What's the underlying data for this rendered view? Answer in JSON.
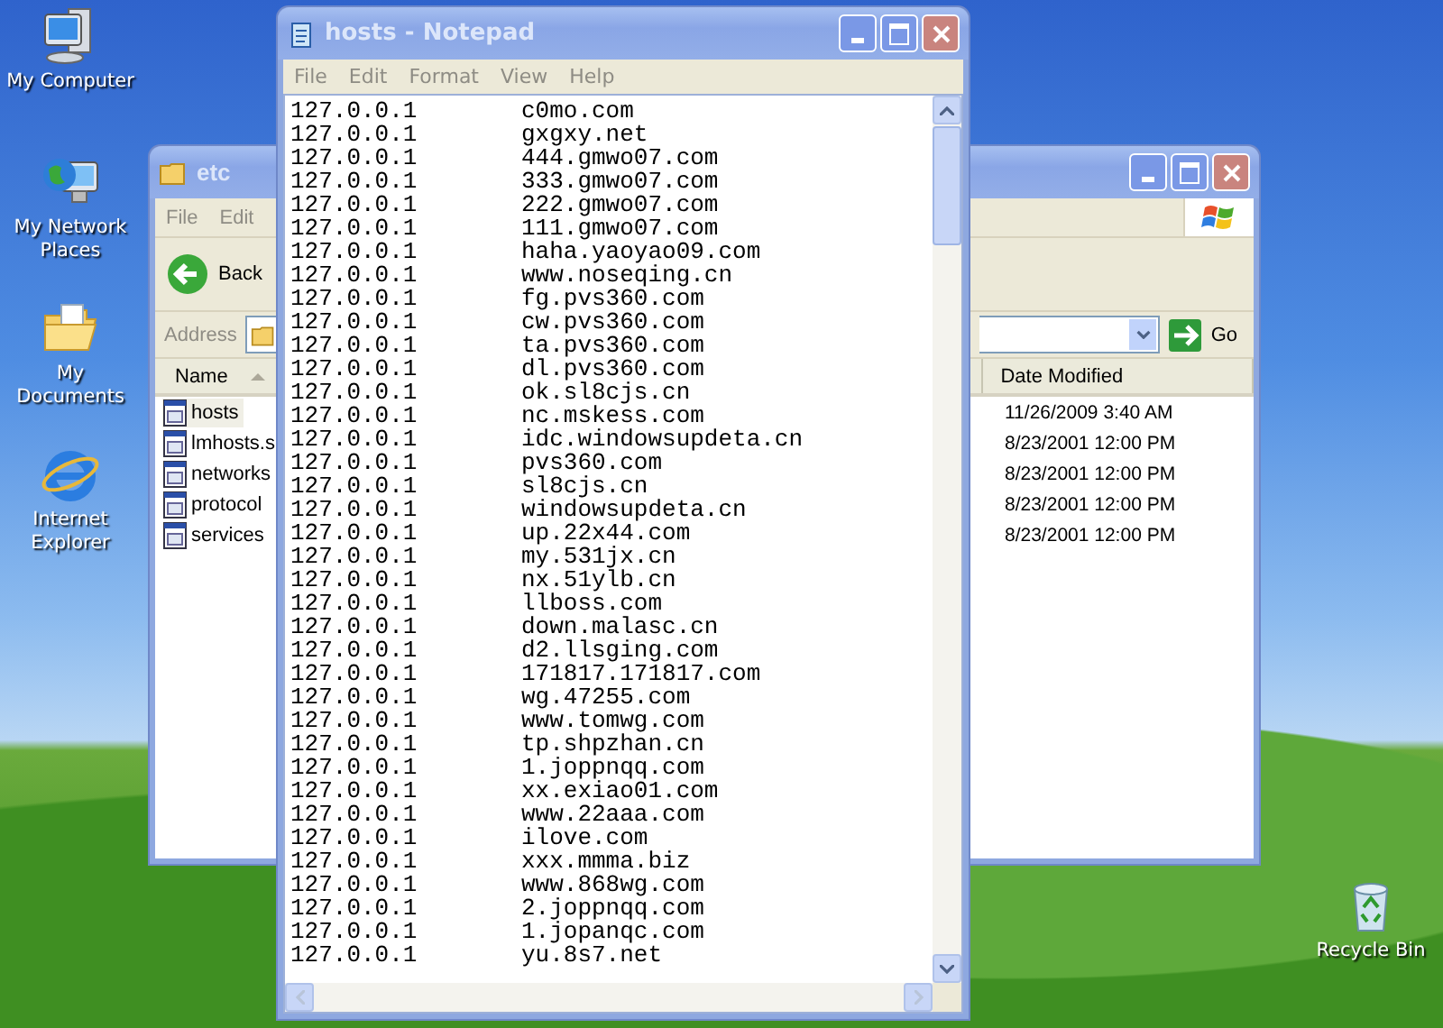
{
  "desktop_icons": [
    {
      "kind": "computer",
      "label": "My Computer"
    },
    {
      "kind": "network",
      "label": "My Network Places"
    },
    {
      "kind": "documents",
      "label": "My Documents"
    },
    {
      "kind": "browser",
      "label": "Internet Explorer"
    }
  ],
  "recycle_bin": {
    "label": "Recycle Bin"
  },
  "explorer": {
    "title": "etc",
    "menu": [
      "File",
      "Edit"
    ],
    "back_button": "Back",
    "address_label": "Address",
    "go_button": "Go",
    "columns": [
      "Name",
      "Date Modified"
    ],
    "files": [
      {
        "name": "hosts",
        "date": "11/26/2009 3:40 AM",
        "selected": true
      },
      {
        "name": "lmhosts.s",
        "date": "8/23/2001 12:00 PM",
        "selected": false
      },
      {
        "name": "networks",
        "date": "8/23/2001 12:00 PM",
        "selected": false
      },
      {
        "name": "protocol",
        "date": "8/23/2001 12:00 PM",
        "selected": false
      },
      {
        "name": "services",
        "date": "8/23/2001 12:00 PM",
        "selected": false
      }
    ]
  },
  "notepad": {
    "title": "hosts - Notepad",
    "menu": [
      "File",
      "Edit",
      "Format",
      "View",
      "Help"
    ],
    "lines": [
      {
        "ip": "127.0.0.1",
        "host": "c0mo.com"
      },
      {
        "ip": "127.0.0.1",
        "host": "gxgxy.net"
      },
      {
        "ip": "127.0.0.1",
        "host": "444.gmwo07.com"
      },
      {
        "ip": "127.0.0.1",
        "host": "333.gmwo07.com"
      },
      {
        "ip": "127.0.0.1",
        "host": "222.gmwo07.com"
      },
      {
        "ip": "127.0.0.1",
        "host": "111.gmwo07.com"
      },
      {
        "ip": "127.0.0.1",
        "host": "haha.yaoyao09.com"
      },
      {
        "ip": "127.0.0.1",
        "host": "www.noseqing.cn"
      },
      {
        "ip": "127.0.0.1",
        "host": "fg.pvs360.com"
      },
      {
        "ip": "127.0.0.1",
        "host": "cw.pvs360.com"
      },
      {
        "ip": "127.0.0.1",
        "host": "ta.pvs360.com"
      },
      {
        "ip": "127.0.0.1",
        "host": "dl.pvs360.com"
      },
      {
        "ip": "127.0.0.1",
        "host": "ok.sl8cjs.cn"
      },
      {
        "ip": "127.0.0.1",
        "host": "nc.mskess.com"
      },
      {
        "ip": "127.0.0.1",
        "host": "idc.windowsupdeta.cn"
      },
      {
        "ip": "127.0.0.1",
        "host": "pvs360.com"
      },
      {
        "ip": "127.0.0.1",
        "host": "sl8cjs.cn"
      },
      {
        "ip": "127.0.0.1",
        "host": "windowsupdeta.cn"
      },
      {
        "ip": "127.0.0.1",
        "host": "up.22x44.com"
      },
      {
        "ip": "127.0.0.1",
        "host": "my.531jx.cn"
      },
      {
        "ip": "127.0.0.1",
        "host": "nx.51ylb.cn"
      },
      {
        "ip": "127.0.0.1",
        "host": "llboss.com"
      },
      {
        "ip": "127.0.0.1",
        "host": "down.malasc.cn"
      },
      {
        "ip": "127.0.0.1",
        "host": "d2.llsging.com"
      },
      {
        "ip": "127.0.0.1",
        "host": "171817.171817.com"
      },
      {
        "ip": "127.0.0.1",
        "host": "wg.47255.com"
      },
      {
        "ip": "127.0.0.1",
        "host": "www.tomwg.com"
      },
      {
        "ip": "127.0.0.1",
        "host": "tp.shpzhan.cn"
      },
      {
        "ip": "127.0.0.1",
        "host": "1.joppnqq.com"
      },
      {
        "ip": "127.0.0.1",
        "host": "xx.exiao01.com"
      },
      {
        "ip": "127.0.0.1",
        "host": "www.22aaa.com"
      },
      {
        "ip": "127.0.0.1",
        "host": "ilove.com"
      },
      {
        "ip": "127.0.0.1",
        "host": "xxx.mmma.biz"
      },
      {
        "ip": "127.0.0.1",
        "host": "www.868wg.com"
      },
      {
        "ip": "127.0.0.1",
        "host": "2.joppnqq.com"
      },
      {
        "ip": "127.0.0.1",
        "host": "1.jopanqc.com"
      },
      {
        "ip": "127.0.0.1",
        "host": "yu.8s7.net"
      }
    ]
  }
}
